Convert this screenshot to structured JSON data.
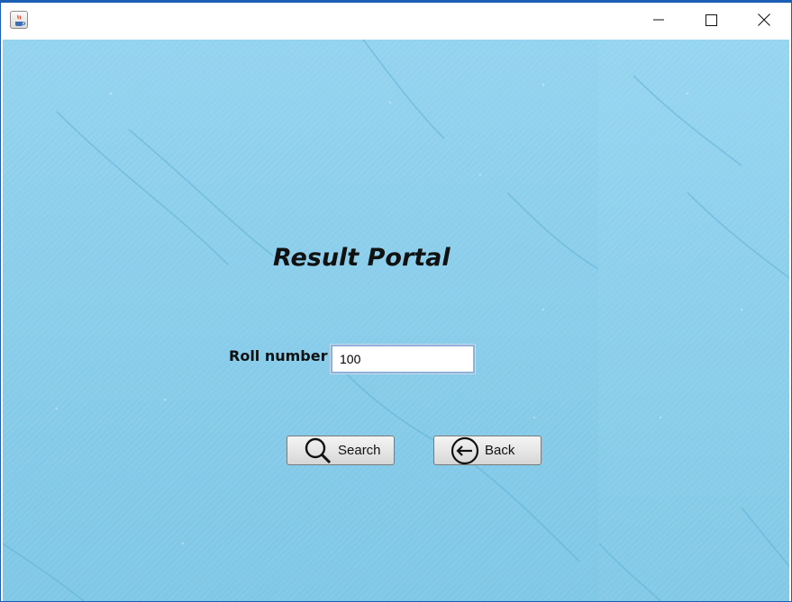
{
  "window": {
    "app_icon": "java-coffee-icon",
    "controls": {
      "minimize_icon": "minimize-icon",
      "maximize_icon": "maximize-icon",
      "close_icon": "close-icon"
    }
  },
  "form": {
    "title": "Result Portal",
    "roll_label": "Roll number",
    "roll_value": "100"
  },
  "buttons": {
    "search_label": "Search",
    "search_icon": "magnifier-icon",
    "back_label": "Back",
    "back_icon": "back-arrow-circle-icon"
  },
  "colors": {
    "frame_border": "#1a5fb4",
    "background": "#88cdea",
    "input_border": "#8fb2d9"
  }
}
